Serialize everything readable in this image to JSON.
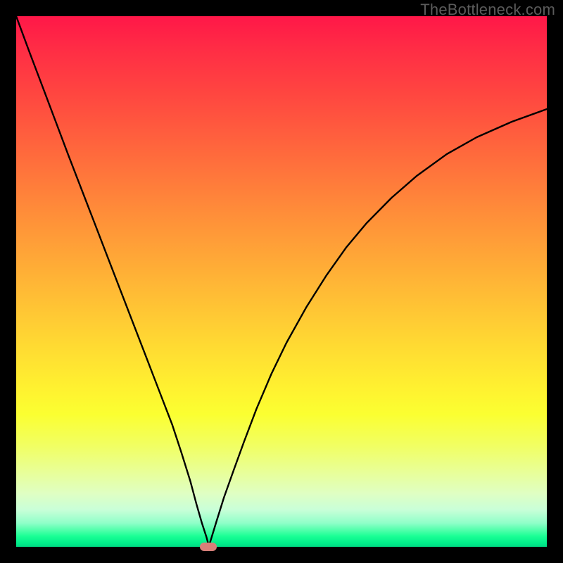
{
  "watermark": "TheBottleneck.com",
  "chart_data": {
    "type": "line",
    "title": "",
    "xlabel": "",
    "ylabel": "",
    "xlim": [
      0,
      100
    ],
    "ylim": [
      0,
      100
    ],
    "grid": false,
    "legend": null,
    "gradient_stops": [
      {
        "pos": 0,
        "color": "#ff1748"
      },
      {
        "pos": 15,
        "color": "#ff4740"
      },
      {
        "pos": 37,
        "color": "#ff8d39"
      },
      {
        "pos": 60,
        "color": "#ffd433"
      },
      {
        "pos": 75,
        "color": "#fbff31"
      },
      {
        "pos": 90,
        "color": "#dfffc3"
      },
      {
        "pos": 97,
        "color": "#1aff95"
      },
      {
        "pos": 100,
        "color": "#00da83"
      }
    ],
    "series": [
      {
        "name": "left-branch",
        "x": [
          0.0,
          2.45,
          4.91,
          7.36,
          9.81,
          12.26,
          14.72,
          17.17,
          19.62,
          22.08,
          24.53,
          26.98,
          29.43,
          31.13,
          32.83,
          33.96,
          34.99,
          35.85,
          36.32
        ],
        "y": [
          100.0,
          93.37,
          86.87,
          80.37,
          73.87,
          67.51,
          61.14,
          54.77,
          48.41,
          42.04,
          35.68,
          29.31,
          22.95,
          17.77,
          12.33,
          8.09,
          4.51,
          1.86,
          0.13
        ]
      },
      {
        "name": "right-branch",
        "x": [
          36.32,
          37.74,
          39.15,
          41.04,
          42.92,
          45.28,
          48.11,
          50.94,
          54.72,
          58.49,
          62.26,
          66.04,
          70.75,
          75.47,
          81.13,
          86.79,
          93.4,
          100.0
        ],
        "y": [
          0.13,
          4.77,
          9.28,
          14.59,
          19.76,
          25.99,
          32.63,
          38.46,
          45.23,
          51.19,
          56.5,
          61.01,
          65.78,
          69.89,
          74.0,
          77.19,
          80.11,
          82.49
        ]
      }
    ],
    "marker": {
      "x": 36.2,
      "y": 0.0,
      "color": "#d77f79"
    }
  }
}
